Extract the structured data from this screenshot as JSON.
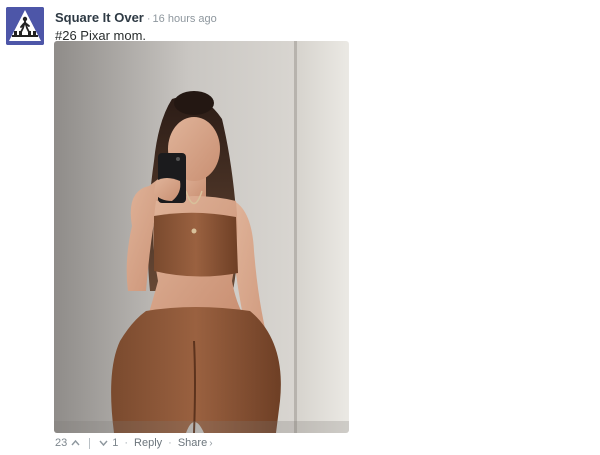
{
  "comment": {
    "author": "Square It Over",
    "separator": "·",
    "timestamp": "16 hours ago",
    "text": "#26 Pixar mom.",
    "avatar_icon": "pedestrian-crossing-sign-icon",
    "avatar_color": "#4d56a8"
  },
  "footer": {
    "upvotes": "23",
    "downvotes": "1",
    "dot": "·",
    "reply_label": "Reply",
    "share_label": "Share",
    "share_arrow": "›"
  }
}
